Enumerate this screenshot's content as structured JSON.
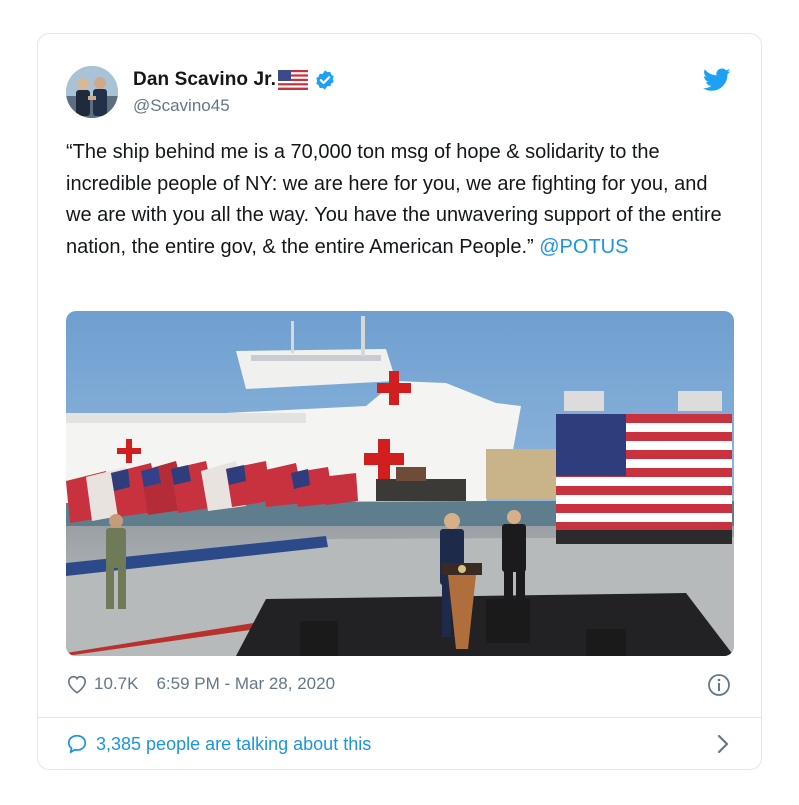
{
  "tweet": {
    "author_name": "Dan Scavino Jr.",
    "handle": "@Scavino45",
    "text_main": "“The ship behind me is a 70,000 ton msg of hope & solidarity to the incredible people of NY: we are here for you, we are fighting for you, and we are with you all the way. You have the unwavering support of the entire nation, the entire gov, & the entire American People.”",
    "mention": "@POTUS",
    "likes": "10.7K",
    "timestamp": "6:59 PM - Mar 28, 2020",
    "talking_about": "3,385 people are talking about this"
  },
  "icons": {
    "avatar": "avatar",
    "flag": "us-flag-emoji-icon",
    "verified": "verified-badge-icon",
    "brand": "twitter-bird-icon",
    "like": "heart-icon",
    "info": "info-icon",
    "reply": "speech-bubble-icon",
    "more": "chevron-right-icon"
  },
  "colors": {
    "accent": "#1b95e0",
    "secondary_text": "#657786",
    "border": "#e1e8ed"
  }
}
